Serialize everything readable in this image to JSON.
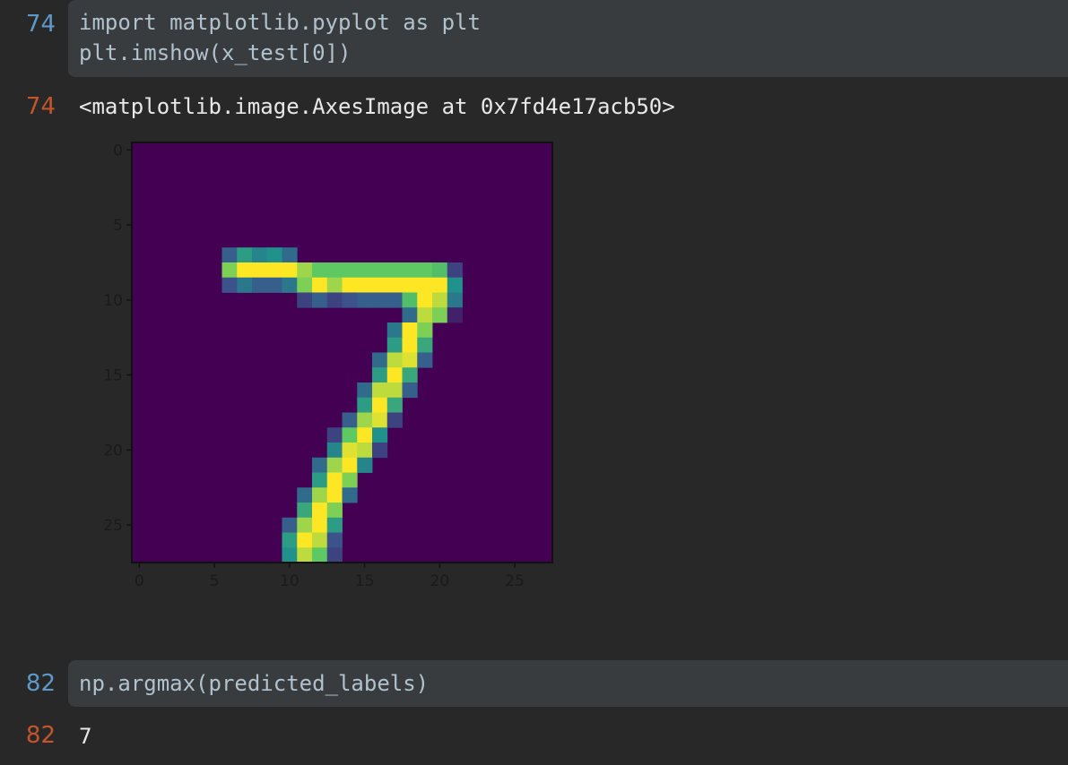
{
  "cells": [
    {
      "in_number": "74",
      "code_lines": [
        "import matplotlib.pyplot as plt",
        "plt.imshow(x_test[0])"
      ],
      "out_number": "74",
      "output_text": "<matplotlib.image.AxesImage at 0x7fd4e17acb50>"
    },
    {
      "in_number": "82",
      "code_lines": [
        "np.argmax(predicted_labels)"
      ],
      "out_number": "82",
      "output_text": "7"
    }
  ],
  "colors": {
    "background": "#282828",
    "code_box": "#383c3f",
    "in_number": "#5e99c9",
    "out_number": "#c2552b",
    "code_text": "#b2c2cd",
    "output_text": "#e8e8e8"
  },
  "chart_data": {
    "type": "heatmap",
    "colormap": "viridis",
    "grid": false,
    "xlim": [
      -0.5,
      27.5
    ],
    "ylim": [
      27.5,
      -0.5
    ],
    "xticks": [
      "0",
      "5",
      "10",
      "15",
      "20",
      "25"
    ],
    "yticks": [
      "0",
      "5",
      "10",
      "15",
      "20",
      "25"
    ],
    "pixel_values": [
      [
        7,
        6,
        0.3
      ],
      [
        7,
        7,
        0.55
      ],
      [
        7,
        8,
        0.45
      ],
      [
        7,
        9,
        0.5
      ],
      [
        7,
        10,
        0.35
      ],
      [
        8,
        6,
        0.8
      ],
      [
        8,
        7,
        1
      ],
      [
        8,
        8,
        1
      ],
      [
        8,
        9,
        1
      ],
      [
        8,
        10,
        1
      ],
      [
        8,
        11,
        0.85
      ],
      [
        8,
        12,
        0.75
      ],
      [
        8,
        13,
        0.75
      ],
      [
        8,
        14,
        0.75
      ],
      [
        8,
        15,
        0.75
      ],
      [
        8,
        16,
        0.75
      ],
      [
        8,
        17,
        0.75
      ],
      [
        8,
        18,
        0.75
      ],
      [
        8,
        19,
        0.75
      ],
      [
        8,
        20,
        0.7
      ],
      [
        8,
        21,
        0.2
      ],
      [
        9,
        6,
        0.25
      ],
      [
        9,
        7,
        0.4
      ],
      [
        9,
        8,
        0.3
      ],
      [
        9,
        9,
        0.3
      ],
      [
        9,
        10,
        0.4
      ],
      [
        9,
        11,
        0.8
      ],
      [
        9,
        12,
        1
      ],
      [
        9,
        13,
        0.85
      ],
      [
        9,
        14,
        1
      ],
      [
        9,
        15,
        1
      ],
      [
        9,
        16,
        1
      ],
      [
        9,
        17,
        1
      ],
      [
        9,
        18,
        1
      ],
      [
        9,
        19,
        1
      ],
      [
        9,
        20,
        1
      ],
      [
        9,
        21,
        0.5
      ],
      [
        10,
        11,
        0.2
      ],
      [
        10,
        12,
        0.3
      ],
      [
        10,
        13,
        0.2
      ],
      [
        10,
        14,
        0.25
      ],
      [
        10,
        15,
        0.3
      ],
      [
        10,
        16,
        0.3
      ],
      [
        10,
        17,
        0.3
      ],
      [
        10,
        18,
        0.7
      ],
      [
        10,
        19,
        1
      ],
      [
        10,
        20,
        0.9
      ],
      [
        10,
        21,
        0.4
      ],
      [
        11,
        18,
        0.35
      ],
      [
        11,
        19,
        0.9
      ],
      [
        11,
        20,
        0.8
      ],
      [
        11,
        21,
        0.1
      ],
      [
        12,
        17,
        0.4
      ],
      [
        12,
        18,
        1
      ],
      [
        12,
        19,
        0.8
      ],
      [
        13,
        17,
        0.55
      ],
      [
        13,
        18,
        1
      ],
      [
        13,
        19,
        0.6
      ],
      [
        14,
        16,
        0.35
      ],
      [
        14,
        17,
        0.9
      ],
      [
        14,
        18,
        0.95
      ],
      [
        14,
        19,
        0.3
      ],
      [
        15,
        16,
        0.55
      ],
      [
        15,
        17,
        1
      ],
      [
        15,
        18,
        0.6
      ],
      [
        16,
        15,
        0.35
      ],
      [
        16,
        16,
        0.9
      ],
      [
        16,
        17,
        0.9
      ],
      [
        16,
        18,
        0.3
      ],
      [
        17,
        15,
        0.55
      ],
      [
        17,
        16,
        1
      ],
      [
        17,
        17,
        0.6
      ],
      [
        18,
        14,
        0.3
      ],
      [
        18,
        15,
        0.85
      ],
      [
        18,
        16,
        0.95
      ],
      [
        18,
        17,
        0.2
      ],
      [
        19,
        13,
        0.2
      ],
      [
        19,
        14,
        0.75
      ],
      [
        19,
        15,
        1
      ],
      [
        19,
        16,
        0.5
      ],
      [
        20,
        13,
        0.45
      ],
      [
        20,
        14,
        0.95
      ],
      [
        20,
        15,
        0.9
      ],
      [
        20,
        16,
        0.2
      ],
      [
        21,
        12,
        0.35
      ],
      [
        21,
        13,
        0.85
      ],
      [
        21,
        14,
        1
      ],
      [
        21,
        15,
        0.45
      ],
      [
        22,
        12,
        0.55
      ],
      [
        22,
        13,
        1
      ],
      [
        22,
        14,
        0.8
      ],
      [
        23,
        11,
        0.35
      ],
      [
        23,
        12,
        0.85
      ],
      [
        23,
        13,
        1
      ],
      [
        23,
        14,
        0.35
      ],
      [
        24,
        11,
        0.6
      ],
      [
        24,
        12,
        1
      ],
      [
        24,
        13,
        0.8
      ],
      [
        25,
        10,
        0.3
      ],
      [
        25,
        11,
        0.85
      ],
      [
        25,
        12,
        1
      ],
      [
        25,
        13,
        0.55
      ],
      [
        26,
        10,
        0.55
      ],
      [
        26,
        11,
        1
      ],
      [
        26,
        12,
        0.9
      ],
      [
        26,
        13,
        0.25
      ],
      [
        27,
        10,
        0.5
      ],
      [
        27,
        11,
        0.9
      ],
      [
        27,
        12,
        0.75
      ],
      [
        27,
        13,
        0.2
      ]
    ]
  }
}
